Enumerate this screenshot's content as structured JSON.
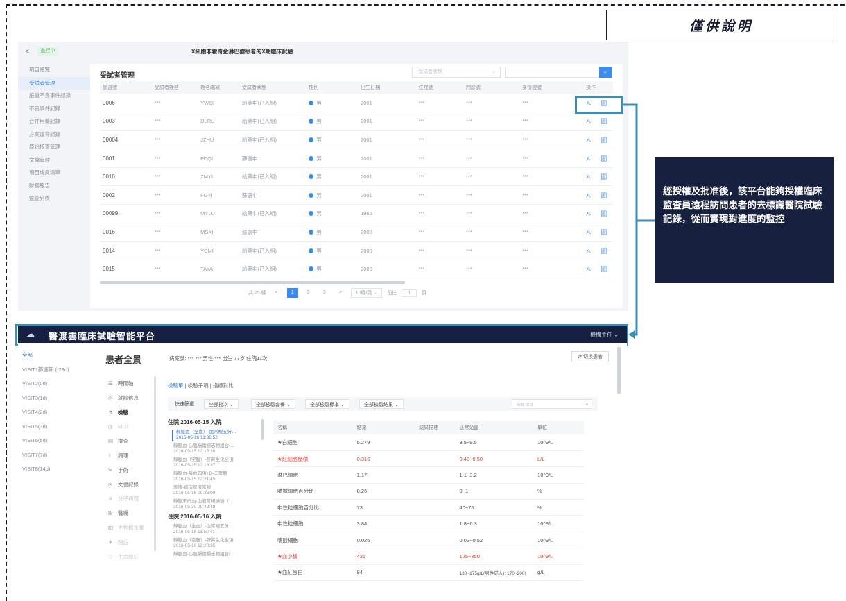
{
  "reference_label": "僅供說明",
  "callout_text": "經授權及批准後，該平台能夠授權臨床監查員遠程訪問患者的去標識醫院試驗記錄，從而實現對進度的監控",
  "top_screen": {
    "back": "<",
    "status": "進行中",
    "study_title": "X細胞非霍奇金淋巴瘤患者的X期臨床試驗",
    "sidebar": [
      "項目總覽",
      "受試者管理",
      "嚴重不良事件記錄",
      "不良事件記錄",
      "合并用藥記錄",
      "方案違背記錄",
      "原始核查管理",
      "文檔管理",
      "項目成員清單",
      "財務報告",
      "監查列表"
    ],
    "page_title": "受試者管理",
    "status_filter_placeholder": "受試者狀態",
    "search_icon": "search-icon",
    "columns": [
      "篩選號",
      "受試者姓名",
      "姓名縮寫",
      "受試者狀態",
      "性別",
      "出生日期",
      "住院號",
      "門診號",
      "身份證號",
      "操作"
    ],
    "rows": [
      {
        "id": "0006",
        "name": "***",
        "abbr": "YWQI",
        "status": "給藥中(已入組)",
        "gender": "男",
        "dob": "2001",
        "inpatient": "***",
        "outpatient": "***",
        "idno": "***"
      },
      {
        "id": "0003",
        "name": "***",
        "abbr": "DLRU",
        "status": "給藥中(已入組)",
        "gender": "男",
        "dob": "2001",
        "inpatient": "***",
        "outpatient": "***",
        "idno": "***"
      },
      {
        "id": "00004",
        "name": "***",
        "abbr": "JZHU",
        "status": "給藥中(已入組)",
        "gender": "男",
        "dob": "2001",
        "inpatient": "***",
        "outpatient": "***",
        "idno": "***"
      },
      {
        "id": "0001",
        "name": "***",
        "abbr": "FDQI",
        "status": "篩選中",
        "gender": "男",
        "dob": "2001",
        "inpatient": "***",
        "outpatient": "***",
        "idno": "***"
      },
      {
        "id": "0010",
        "name": "***",
        "abbr": "ZMYI",
        "status": "給藥中(已入組)",
        "gender": "男",
        "dob": "2001",
        "inpatient": "***",
        "outpatient": "***",
        "idno": "***"
      },
      {
        "id": "0002",
        "name": "***",
        "abbr": "FGYI",
        "status": "篩選中",
        "gender": "男",
        "dob": "2001",
        "inpatient": "***",
        "outpatient": "***",
        "idno": "***"
      },
      {
        "id": "00099",
        "name": "***",
        "abbr": "MYLU",
        "status": "給藥中(已入組)",
        "gender": "男",
        "dob": "1965",
        "inpatient": "***",
        "outpatient": "***",
        "idno": "***"
      },
      {
        "id": "0016",
        "name": "***",
        "abbr": "MSXI",
        "status": "篩選中",
        "gender": "男",
        "dob": "2000",
        "inpatient": "***",
        "outpatient": "***",
        "idno": "***"
      },
      {
        "id": "0014",
        "name": "***",
        "abbr": "YCMI",
        "status": "給藥中(已入組)",
        "gender": "男",
        "dob": "2000",
        "inpatient": "***",
        "outpatient": "***",
        "idno": "***"
      },
      {
        "id": "0015",
        "name": "***",
        "abbr": "TAYA",
        "status": "給藥中(已入組)",
        "gender": "男",
        "dob": "2000",
        "inpatient": "***",
        "outpatient": "***",
        "idno": "***"
      }
    ],
    "op_icons": "ዶ 圖",
    "pager": {
      "total": "共 25 條",
      "prev": "<",
      "pages": [
        "1",
        "2",
        "3"
      ],
      "next": ">",
      "page_size": "10條/頁 ⌄",
      "goto_label": "前往",
      "goto_value": "1",
      "goto_unit": "頁"
    }
  },
  "bottom_screen": {
    "app_name": "醫渡雲臨床試驗智能平台",
    "user": "機構主任 ⌄",
    "visits": [
      "全部",
      "VISIT1篩選期 (-28d)",
      "VISIT2(0d)",
      "VISIT3(1d)",
      "VISIT4(2d)",
      "VISIT5(3d)",
      "VISIT6(5d)",
      "VISIT7(7d)",
      "VISIT8(14d)"
    ],
    "panel_title": "患者全景",
    "patient_info": "病案號: ***   ***   男性   *** 出生   77岁   住院11次",
    "switch_patient": "⇄ 切換患者",
    "nav": [
      {
        "icon": "☰",
        "label": "時間軸"
      },
      {
        "icon": "◷",
        "label": "就診信息"
      },
      {
        "icon": "⚗",
        "label": "檢驗"
      },
      {
        "icon": "◎",
        "label": "MDT"
      },
      {
        "icon": "▤",
        "label": "檢查"
      },
      {
        "icon": "⚕",
        "label": "病理"
      },
      {
        "icon": "✂",
        "label": "手術"
      },
      {
        "icon": "✉",
        "label": "文書記錄"
      },
      {
        "icon": "⚛",
        "label": "分子病理"
      },
      {
        "icon": "℞",
        "label": "醫囑"
      },
      {
        "icon": "▥",
        "label": "生物樣本庫"
      },
      {
        "icon": "⚘",
        "label": "隨訪"
      },
      {
        "icon": "♡",
        "label": "生命體征"
      }
    ],
    "tabs": [
      "檢驗單",
      "檢驗子項",
      "指標對比"
    ],
    "filter": {
      "label": "快速篩選",
      "selects": [
        "全部批次 ⌄",
        "全部檢驗套餐 ⌄",
        "全部檢驗標本 ⌄",
        "全部檢驗結果 ⌄"
      ],
      "search_placeholder": "檢驗項目"
    },
    "visit_records": [
      {
        "header": "住院 2016-05-15 入院"
      },
      {
        "title": "靜脈血（全血）-血常規五分…",
        "time": "2016-05-16 11:36:52",
        "selected": true
      },
      {
        "title": "靜脈血-心肌損傷標志物組合(…",
        "time": "2016-05-15 12:15:30"
      },
      {
        "title": "靜脈血（空腹）-肝腎生化全項",
        "time": "2016-05-15 12:16:37"
      },
      {
        "title": "靜脈血-凝血四項+D-二聚體",
        "time": "2016-05-15 12:21:45"
      },
      {
        "title": "尿液-病房尿液常規",
        "time": "2016-05-16 09:36:09"
      },
      {
        "title": "靜脈末梢血-血液常規檢驗（…",
        "time": "2016-05-20 09:42:48"
      },
      {
        "header": "住院 2016-05-16 入院"
      },
      {
        "title": "靜脈血（全血）-血常規五分…",
        "time": "2016-05-16 11:50:41"
      },
      {
        "title": "靜脈血（空腹）-肝腎生化全項",
        "time": "2016-05-16 12:20:35"
      },
      {
        "title": "靜脈血-心肌損傷標志物組合(…",
        "time": ""
      }
    ],
    "lab_columns": [
      "名稱",
      "結果",
      "結果描述",
      "正常范圍",
      "單位"
    ],
    "lab_rows": [
      {
        "name": "★白細胞",
        "result": "5.279",
        "desc": "",
        "range": "3.5~9.5",
        "unit": "10^9/L",
        "abnormal": false
      },
      {
        "name": "★紅細胞壓積",
        "result": "0.316",
        "desc": "",
        "range": "0.40~0.50",
        "unit": "L/L",
        "abnormal": true
      },
      {
        "name": "淋巴細胞",
        "result": "1.17",
        "desc": "",
        "range": "1.1~3.2",
        "unit": "10^9/L",
        "abnormal": false
      },
      {
        "name": "嗜堿細胞百分比",
        "result": "0.26",
        "desc": "",
        "range": "0~1",
        "unit": "%",
        "abnormal": false
      },
      {
        "name": "中性粒細胞百分比",
        "result": "73",
        "desc": "",
        "range": "40~75",
        "unit": "%",
        "abnormal": false
      },
      {
        "name": "中性粒細胞",
        "result": "3.84",
        "desc": "",
        "range": "1.8~6.3",
        "unit": "10^9/L",
        "abnormal": false
      },
      {
        "name": "嗜酸細胞",
        "result": "0.026",
        "desc": "",
        "range": "0.02~0.52",
        "unit": "10^9/L",
        "abnormal": false
      },
      {
        "name": "★血小板",
        "result": "431",
        "desc": "",
        "range": "125~350",
        "unit": "10^9/L",
        "abnormal": true
      },
      {
        "name": "★血紅蛋白",
        "result": "84",
        "desc": "",
        "range": "130~175g/L(男性成人); 170~200)",
        "unit": "g/L",
        "abnormal": false
      }
    ]
  },
  "colors": {
    "navy": "#182040",
    "accent_blue": "#3b8cf0",
    "connector": "#3c8db5",
    "abnormal_red": "#e0453a"
  }
}
